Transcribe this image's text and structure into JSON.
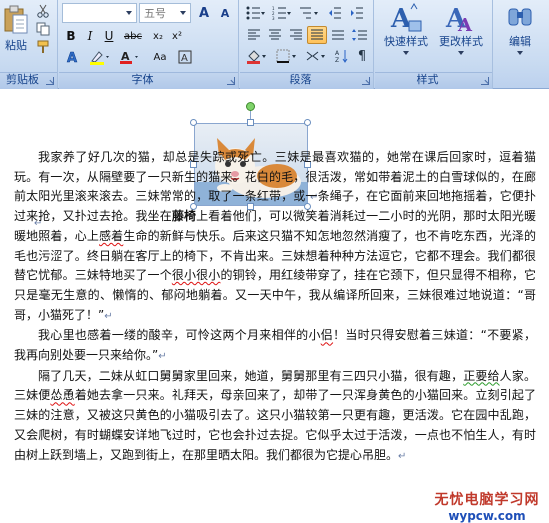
{
  "ribbon": {
    "clipboard": {
      "paste_label": "粘贴",
      "group_label": "剪贴板"
    },
    "font": {
      "font_size": "五号",
      "group_label": "字体",
      "grow_glyph": "A",
      "shrink_glyph": "A",
      "bold": "B",
      "italic": "I",
      "underline": "U",
      "abc": "abc",
      "highlight_glyph": "A",
      "fontcolor_glyph": "A",
      "case_glyph": "Aa"
    },
    "paragraph": {
      "group_label": "段落"
    },
    "styles": {
      "quick_styles_label": "快速样式",
      "change_styles_label": "更改样式",
      "group_label": "样式",
      "edit_label": "编辑"
    }
  },
  "document": {
    "para_mark": "↵",
    "paragraphs": [
      {
        "parts": [
          {
            "t": "我家养了好几次的猫，却总是失踪或死亡。三妹是最喜欢猫的，她常在课后回家时，逗着猫玩。有一次，从隔壁要了一只新生的猫来。花白的毛，很活泼，常如带着泥土的白雪球似的，在廊前太阳光里滚来滚去。三妹常常的，取了一条红带，或一条绳子，在它面前来回地拖摇着，它便扑过来抢，又扑过去抢。我坐在"
          },
          {
            "t": "藤椅",
            "cls": "bold"
          },
          {
            "t": "上看着他们，可以微笑着消耗过一二小时的光阴，那时太阳光暖暖地照着，心上"
          },
          {
            "t": "感着",
            "cls": "sq"
          },
          {
            "t": "生命的新鲜与快乐。后来这只猫不知怎地忽然消瘦了，也不肯吃东西，光泽的毛也污涩了。终日躺在客厅上的椅下，不肯出来。三妹想着种种方法逗它，它都不理会。我们都很替它忧郁。三妹特地买了一个"
          },
          {
            "t": "很小很小",
            "cls": "sq"
          },
          {
            "t": "的铜铃，用红绫带穿了，挂在它颈下，但只显得不相称，它只是毫无生意的、懒惰的、郁闷地躺着。又一天中午，我从编译所回来，三妹很难过地说道：“哥哥，小猫死了！”"
          }
        ]
      },
      {
        "parts": [
          {
            "t": "我心里也感着一缕的酸辛，可怜这两个月来相伴的小"
          },
          {
            "t": "侣",
            "cls": "sq"
          },
          {
            "t": "！当时只得安慰着三妹道：“不要紧，我再向别处要一只来给你。”"
          }
        ]
      },
      {
        "parts": [
          {
            "t": "隔了几天，二妹从虹口舅舅家里回来，她道，舅舅那里有三四只小猫，很有趣，"
          },
          {
            "t": "正要给",
            "cls": "grn"
          },
          {
            "t": "人家。三妹便"
          },
          {
            "t": "怂恿",
            "cls": "sq"
          },
          {
            "t": "着她去拿一只来。礼拜天，母亲回来了，却带了一只浑身黄色的小猫回来。立刻引起了三妹的注意，又被这只黄色的小猫吸引去了。这只小猫较第一只更有趣，更活泼。它在园中乱跑，又会爬树，有时蝴蝶安详地飞过时，它也会扑过去捉。它似乎太过于活泼，一点也不怕生人，有时由树上跃到墙上，又跑到街上，在那里晒太阳。我们都很为它提心吊胆。"
          }
        ]
      }
    ]
  },
  "watermark": {
    "line1": "无忧电脑学习网",
    "line2": "wypcw.com"
  },
  "colors": {
    "ribbon_bg": "#c9dbf1",
    "group_label": "#15428b",
    "accent_highlight": "#ffd98c"
  }
}
